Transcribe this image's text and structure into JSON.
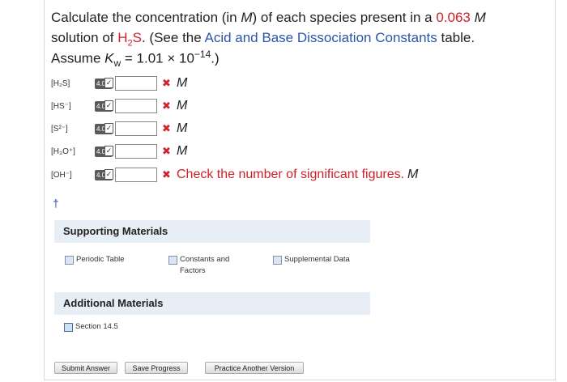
{
  "question": {
    "line1_prefix": "Calculate the concentration (in ",
    "line1_unit": "M",
    "line1_mid": ") of each species present in a ",
    "concentration": "0.063",
    "line1_end": " M",
    "line2_prefix": "solution of ",
    "formula": "H",
    "formula_sub": "2",
    "formula_end": "S",
    "line2_mid": ". (See the ",
    "table_link": "Acid and Base Dissociation Constants",
    "line2_end": " table.",
    "assume_prefix": "Assume ",
    "kw": "K",
    "kw_sub": "w",
    "assume_eq": " = 1.01 × 10",
    "assume_exp": "−14",
    "assume_end": ".)"
  },
  "rows": [
    {
      "species": "[H₂S]",
      "sf": "4.0",
      "unit": "M",
      "message": ""
    },
    {
      "species": "[HS⁻]",
      "sf": "4.0",
      "unit": "M",
      "message": ""
    },
    {
      "species": "[S²⁻]",
      "sf": "4.0",
      "unit": "M",
      "message": ""
    },
    {
      "species": "[H₃O⁺]",
      "sf": "4.0",
      "unit": "M",
      "message": ""
    },
    {
      "species": "[OH⁻]",
      "sf": "4.0",
      "unit": "M",
      "message": "Check the number of significant figures."
    }
  ],
  "dagger": "†",
  "supporting": {
    "title": "Supporting Materials",
    "links": [
      "Periodic Table",
      "Constants and Factors",
      "Supplemental Data"
    ]
  },
  "additional": {
    "title": "Additional Materials",
    "links": [
      "Section 14.5"
    ]
  },
  "buttons": {
    "submit": "Submit Answer",
    "save": "Save Progress",
    "practice": "Practice Another Version"
  },
  "colors": {
    "accent_red": "#d0202a",
    "link_blue": "#2a56a6",
    "panel_bg": "#e8eef6"
  }
}
